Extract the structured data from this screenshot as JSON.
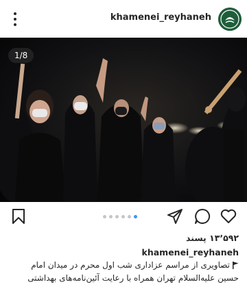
{
  "header": {
    "username": "khamenei_reyhaneh",
    "more_icon": "more-vertical-icon",
    "avatar_icon": "profile-logo-icon"
  },
  "post": {
    "slide_counter": "1/8",
    "slide_index": 1,
    "slide_total": 8,
    "image_subject": "photo"
  },
  "actions": {
    "like_icon": "heart-icon",
    "comment_icon": "comment-icon",
    "share_icon": "send-icon",
    "save_icon": "bookmark-icon",
    "carousel_dots": 6,
    "active_dot": 6,
    "accent_color": "#3897f0"
  },
  "stats": {
    "likes": "۱۳٬۵۹۲ پسند"
  },
  "caption": {
    "username": "khamenei_reyhaneh",
    "flag_icon": "flag-icon",
    "text": "تصاویری از مراسم عزاداری شب اول محرم در میدان امام حسین علیه‌السلام تهران همراه با رعایت آئین‌نامه‌های بهداشتی"
  }
}
